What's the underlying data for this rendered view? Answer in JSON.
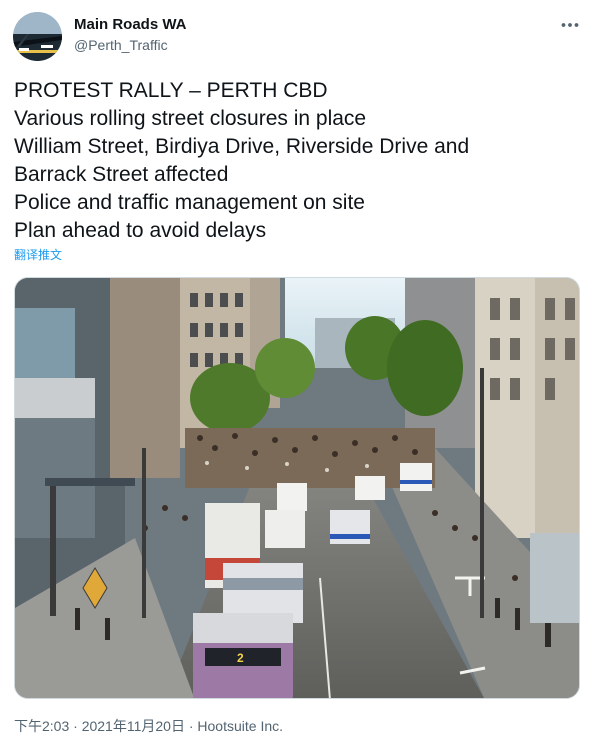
{
  "account": {
    "name": "Main Roads WA",
    "handle": "@Perth_Traffic",
    "avatar_icon": "bridge-photo-avatar"
  },
  "tweet": {
    "lines": [
      "PROTEST RALLY – PERTH CBD",
      "Various rolling street closures in place",
      "William Street, Birdiya Drive, Riverside Drive and",
      "Barrack Street affected",
      "Police and traffic management on site",
      "Plan ahead to avoid delays"
    ],
    "translate_label": "翻译推文"
  },
  "media": {
    "icon": "traffic-camera-photo",
    "bus_number": "2"
  },
  "meta": {
    "time": "下午2:03",
    "separator": "·",
    "date": "2021年11月20日",
    "source": "Hootsuite Inc."
  },
  "colors": {
    "accent": "#1d9bf0",
    "text": "#0f1419",
    "secondary": "#536471"
  }
}
